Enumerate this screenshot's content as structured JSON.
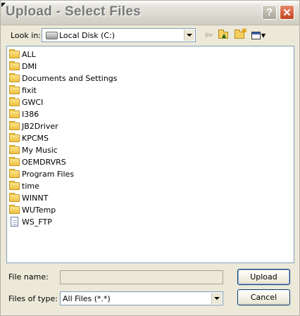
{
  "window": {
    "title": "Upload - Select Files",
    "help_glyph": "?",
    "close_glyph": "✕"
  },
  "toolbar": {
    "look_in_label": "Look in:",
    "look_in_value": "Local Disk (C:)",
    "back_glyph": "⇦"
  },
  "files": [
    {
      "name": "ALL",
      "icon": "folder-icon"
    },
    {
      "name": "DMI",
      "icon": "folder-icon"
    },
    {
      "name": "Documents and Settings",
      "icon": "folder-icon"
    },
    {
      "name": "fixit",
      "icon": "folder-icon"
    },
    {
      "name": "GWCI",
      "icon": "folder-icon"
    },
    {
      "name": "I386",
      "icon": "folder-icon"
    },
    {
      "name": "JB2Driver",
      "icon": "folder-icon"
    },
    {
      "name": "KPCMS",
      "icon": "folder-icon"
    },
    {
      "name": "My Music",
      "icon": "folder-icon"
    },
    {
      "name": "OEMDRVRS",
      "icon": "folder-icon"
    },
    {
      "name": "Program Files",
      "icon": "folder-icon"
    },
    {
      "name": "time",
      "icon": "folder-icon"
    },
    {
      "name": "WINNT",
      "icon": "folder-icon"
    },
    {
      "name": "WUTemp",
      "icon": "folder-icon"
    },
    {
      "name": "WS_FTP",
      "icon": "document-icon"
    }
  ],
  "form": {
    "file_name_label": "File name:",
    "file_name_value": "",
    "files_of_type_label": "Files of type:",
    "files_of_type_value": "All Files (*.*)"
  },
  "buttons": {
    "upload": "Upload",
    "cancel": "Cancel"
  }
}
